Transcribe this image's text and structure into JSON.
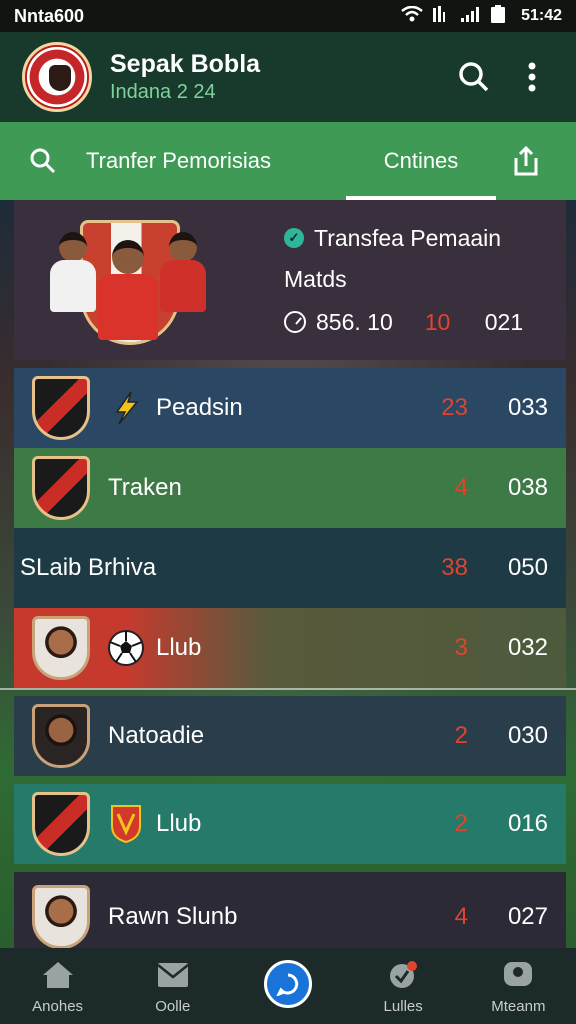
{
  "status": {
    "carrier": "Nnta600",
    "time": "51:42"
  },
  "header": {
    "app_name": "Sepak Bobla",
    "subtitle": "Indana 2 24"
  },
  "tabs": {
    "transfer": "Tranfer Pemorisias",
    "active": "Cntines"
  },
  "featured": {
    "title": "Transfea Pemaain",
    "subtitle": "Matds",
    "value": "856. 10",
    "num": "10",
    "points": "021"
  },
  "rows": [
    {
      "label": "Peadsin",
      "num": "23",
      "points": "033",
      "bg": "#2a4763"
    },
    {
      "label": "Traken",
      "num": "4",
      "points": "038",
      "bg": "#3d7a45"
    },
    {
      "label": "SLaib Brhiva",
      "num": "38",
      "points": "050",
      "bg": "#1e3a44"
    },
    {
      "label": "Llub",
      "num": "3",
      "points": "032",
      "bg": "#4d5a3c"
    },
    {
      "label": "Natoadie",
      "num": "2",
      "points": "030",
      "bg": "#2a3d4a"
    },
    {
      "label": "Llub",
      "num": "2",
      "points": "016",
      "bg": "#257a6a"
    },
    {
      "label": "Rawn Slunb",
      "num": "4",
      "points": "027",
      "bg": "#2c2a36"
    }
  ],
  "bottom_nav": {
    "home": "Anohes",
    "inbox": "Oolle",
    "stats": "Lulles",
    "account": "Mteanm"
  },
  "colors": {
    "header_bg": "#173a2c",
    "tab_bg": "#3f9a55",
    "accent_red": "#e0442e"
  }
}
